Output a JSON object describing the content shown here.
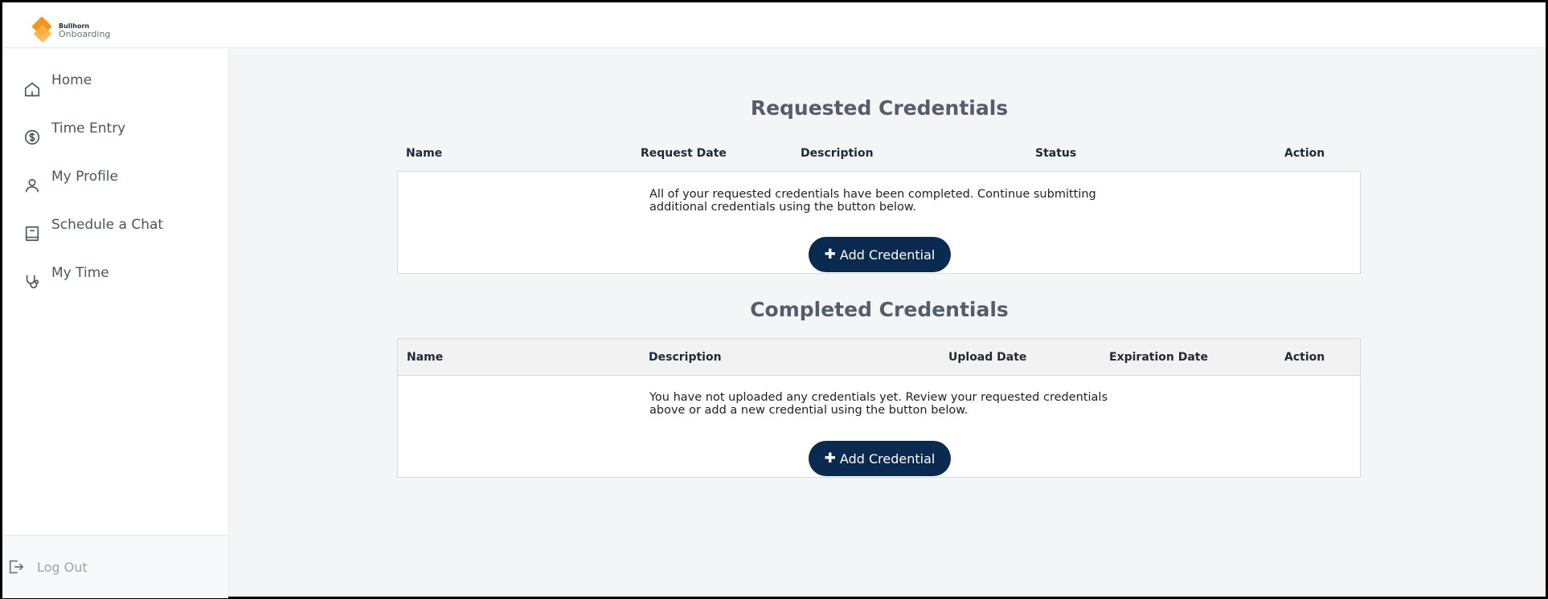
{
  "brand": {
    "small": "Bullhorn",
    "name": "Onboarding",
    "colors": {
      "primary": "#f7941d",
      "secondary": "#fbb040"
    }
  },
  "sidebar": {
    "items": [
      {
        "label": "Home",
        "icon": "home-icon"
      },
      {
        "label": "Time Entry",
        "icon": "dollar-circle-icon"
      },
      {
        "label": "My Profile",
        "icon": "user-icon"
      },
      {
        "label": "Schedule a Chat",
        "icon": "book-icon"
      },
      {
        "label": "My Time",
        "icon": "stethoscope-icon"
      }
    ],
    "logout_label": "Log Out"
  },
  "requested": {
    "title": "Requested Credentials",
    "columns": [
      "Name",
      "Request Date",
      "Description",
      "Status",
      "Action"
    ],
    "empty_line1": "All of your requested credentials have been completed. Continue submitting",
    "empty_line2": "additional credentials using the button below.",
    "button_label": "Add Credential"
  },
  "completed": {
    "title": "Completed Credentials",
    "columns": [
      "Name",
      "Description",
      "Upload Date",
      "Expiration Date",
      "Action"
    ],
    "empty_line1": "You have not uploaded any credentials yet. Review your requested credentials",
    "empty_line2": "above or add a new credential using the button below.",
    "button_label": "Add Credential"
  },
  "colors": {
    "button": "#0b2a4f",
    "title": "#555c6b"
  }
}
